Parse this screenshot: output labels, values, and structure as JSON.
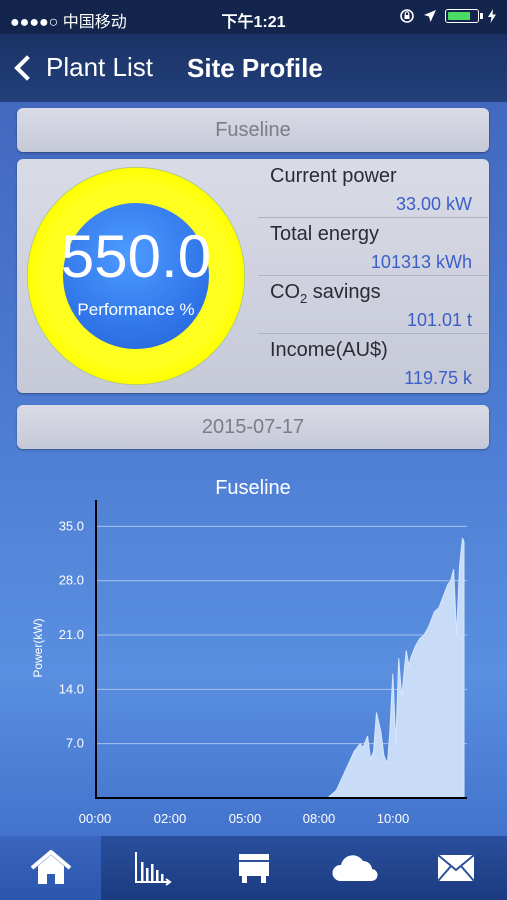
{
  "status": {
    "carrier": "●●●●○ 中国移动",
    "time": "下午1:21"
  },
  "nav": {
    "back_label": "Plant List",
    "title": "Site Profile"
  },
  "site_name": "Fuseline",
  "gauge": {
    "value": "550.0",
    "label": "Performance %"
  },
  "stats": [
    {
      "label": "Current power",
      "value": "33.00 kW"
    },
    {
      "label": "Total energy",
      "value": "101313 kWh"
    },
    {
      "label_pre": "CO",
      "label_sub": "2",
      "label_post": " savings",
      "value": "101.01 t"
    },
    {
      "label": "Income(AU$)",
      "value": "119.75 k"
    }
  ],
  "date": "2015-07-17",
  "tabs": [
    "home-icon",
    "chart-icon",
    "inverter-icon",
    "weather-icon",
    "mail-icon"
  ],
  "chart_data": {
    "type": "area",
    "title": "Fuseline",
    "ylabel": "Power(kW)",
    "xlabel": "",
    "ylim": [
      0,
      38.4
    ],
    "xlim": [
      0,
      12.5
    ],
    "yticks": [
      "7.0",
      "14.0",
      "21.0",
      "28.0",
      "35.0"
    ],
    "ytick_values": [
      7,
      14,
      21,
      28,
      35
    ],
    "xticks": [
      "00:00",
      "02:00",
      "05:00",
      "08:00",
      "10:00"
    ],
    "xtick_values": [
      0,
      2,
      4,
      6,
      8
    ],
    "grid": true,
    "fill_color": "#c8dcf8",
    "x": [
      0,
      7.8,
      8.1,
      8.4,
      8.7,
      8.9,
      9.0,
      9.15,
      9.25,
      9.35,
      9.45,
      9.6,
      9.7,
      9.75,
      9.82,
      9.9,
      10.0,
      10.1,
      10.2,
      10.3,
      10.45,
      10.55,
      10.6,
      10.75,
      10.9,
      11.05,
      11.2,
      11.3,
      11.4,
      11.55,
      11.7,
      11.85,
      11.95,
      12.05,
      12.15,
      12.25,
      12.35,
      12.4
    ],
    "y": [
      0,
      0,
      1.0,
      3.5,
      6.0,
      7.0,
      6.5,
      8.0,
      5.0,
      6.0,
      11.0,
      8.5,
      5.5,
      5.0,
      4.5,
      8.5,
      16.0,
      7.0,
      18.0,
      13.0,
      19.0,
      17.0,
      18.0,
      19.5,
      20.5,
      21.0,
      22.0,
      23.0,
      24.0,
      24.5,
      26.0,
      27.5,
      28.0,
      29.5,
      21.0,
      30.0,
      33.5,
      33.0
    ]
  }
}
